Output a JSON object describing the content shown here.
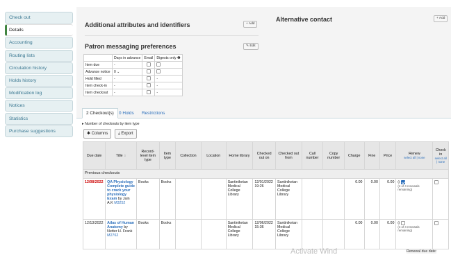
{
  "sidebar": {
    "items": [
      {
        "label": "Check out"
      },
      {
        "label": "Details"
      },
      {
        "label": "Accounting"
      },
      {
        "label": "Routing lists"
      },
      {
        "label": "Circulation history"
      },
      {
        "label": "Holds history"
      },
      {
        "label": "Modification log"
      },
      {
        "label": "Notices"
      },
      {
        "label": "Statistics"
      },
      {
        "label": "Purchase suggestions"
      }
    ]
  },
  "attributes": {
    "title": "Additional attributes and identifiers",
    "add_label": "+ Add"
  },
  "alt_contact": {
    "title": "Alternative contact",
    "add_label": "+ Add"
  },
  "messaging": {
    "title": "Patron messaging preferences",
    "edit_label": "✎ Edit",
    "headers": [
      "Days in advance",
      "Email",
      "Digests only ❶"
    ],
    "rows": [
      {
        "name": "Item due",
        "days": "-",
        "digest": "-"
      },
      {
        "name": "Advance notice",
        "days": "0",
        "digest": "-"
      },
      {
        "name": "Hold filled",
        "days": "-",
        "digest": "-"
      },
      {
        "name": "Item check-in",
        "days": "-",
        "digest": "-"
      },
      {
        "name": "Item checkout",
        "days": "-",
        "digest": "-"
      }
    ]
  },
  "tabs": [
    "2 Checkout(s)",
    "0 Holds",
    "Restrictions"
  ],
  "checkouts": {
    "toggle": "Number of checkouts by item type",
    "columns_btn": "Columns",
    "export_btn": "Export",
    "headers": {
      "due": "Due date",
      "title": "Title",
      "record": "Record-level item type",
      "itype": "Item type",
      "collection": "Collection",
      "location": "Location",
      "home": "Home library",
      "checked_on": "Checked out on",
      "checked_from": "Checked out from",
      "callnumber": "Call number",
      "copy": "Copy number",
      "charge": "Charge",
      "fine": "Fine",
      "price": "Price",
      "renew": "Renew",
      "renew_sel": "select all | none",
      "checkin": "Check in",
      "checkin_sel": "select all | none"
    },
    "group_label": "Previous checkouts",
    "rows": [
      {
        "due": "12/08/2022",
        "title": "QA Physiology Complete guide to crack your physiology Exam",
        "author": "by Jain A.K",
        "callno": "M3252",
        "record_type": "Books",
        "item_type": "Books",
        "home": "Santiniketan Medical College Library",
        "checked_on": "12/01/2022 19:26",
        "checked_from": "Santiniketan Medical College Library",
        "charge": "0.00",
        "fine": "0.00",
        "price": "0.00",
        "renew_count": "0",
        "renew_note": "(4 of 4 renewals remaining)",
        "renew_checked": true
      },
      {
        "due": "12/13/2022",
        "title": "Atlas of Human Anatomy",
        "author": "by Netter H. Frank",
        "callno": "M2762",
        "record_type": "Books",
        "item_type": "Books",
        "home": "Santiniketan Medical College Library",
        "checked_on": "12/06/2022 15:36",
        "checked_from": "Santiniketan Medical College Library",
        "charge": "0.00",
        "fine": "0.00",
        "price": "0.00",
        "renew_count": "0",
        "renew_note": "(4 of 4 renewals remaining)",
        "renew_checked": false
      }
    ],
    "renewal_date_label": "Renewal due date:"
  },
  "watermark": "Activate Wind"
}
